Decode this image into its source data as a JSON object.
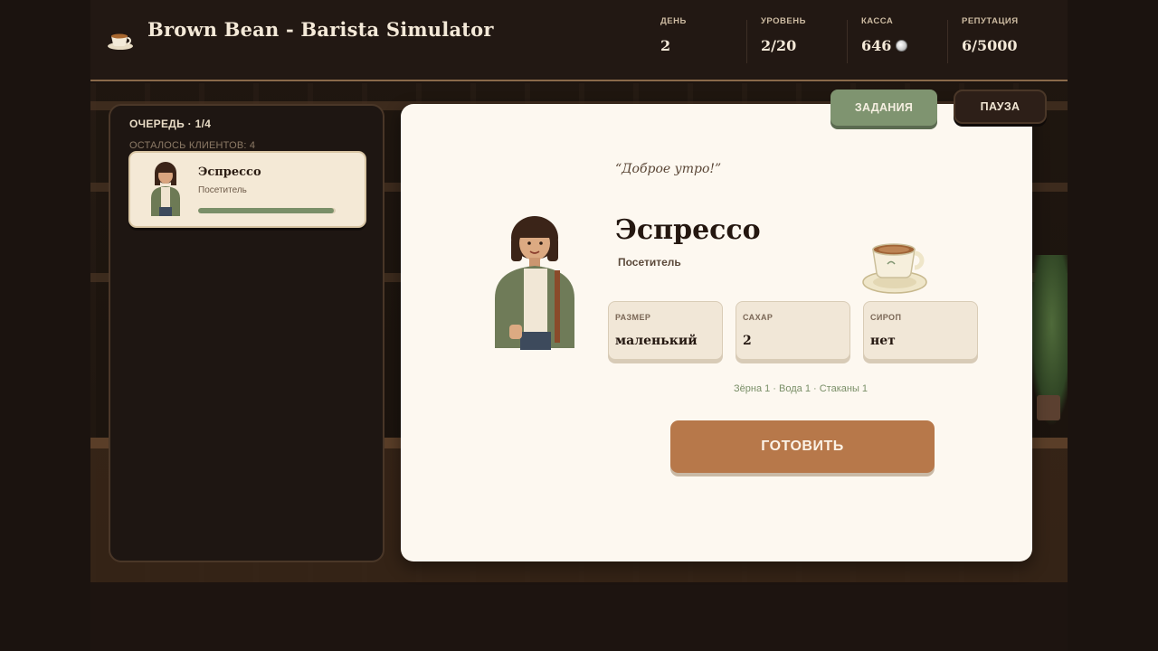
{
  "app": {
    "title": "Brown Bean - Barista Simulator",
    "logo_icon": "coffee-cup-icon"
  },
  "stats": [
    {
      "label": "ДЕНЬ",
      "value": "2"
    },
    {
      "label": "УРОВЕНЬ",
      "value": "2/20"
    },
    {
      "label": "КАССА",
      "value": "646",
      "icon": "coin-icon"
    },
    {
      "label": "РЕПУТАЦИЯ",
      "value": "6/5000"
    }
  ],
  "queue": {
    "title": "ОЧЕРЕДЬ · 1/4",
    "remaining": "ОСТАЛОСЬ КЛИЕНТОВ: 4",
    "cards": [
      {
        "drink": "Эспрессо",
        "role": "Посетитель",
        "patience": 0.99
      }
    ]
  },
  "buttons": {
    "tasks": "ЗАДАНИЯ",
    "pause": "ПАУЗА",
    "make": "ГОТОВИТЬ"
  },
  "order": {
    "greeting": "“Доброе утро!”",
    "drink": "Эспрессо",
    "role": "Посетитель",
    "options": [
      {
        "label": "РАЗМЕР",
        "value": "маленький"
      },
      {
        "label": "САХАР",
        "value": "2"
      },
      {
        "label": "СИРОП",
        "value": "нет"
      }
    ],
    "ingredients": "Зёрна 1 · Вода 1 · Стаканы 1"
  },
  "colors": {
    "accent_green": "#7f9470",
    "accent_brown": "#b7784a",
    "panel_dark": "#1e1612",
    "card_cream": "#fdf8f0"
  }
}
